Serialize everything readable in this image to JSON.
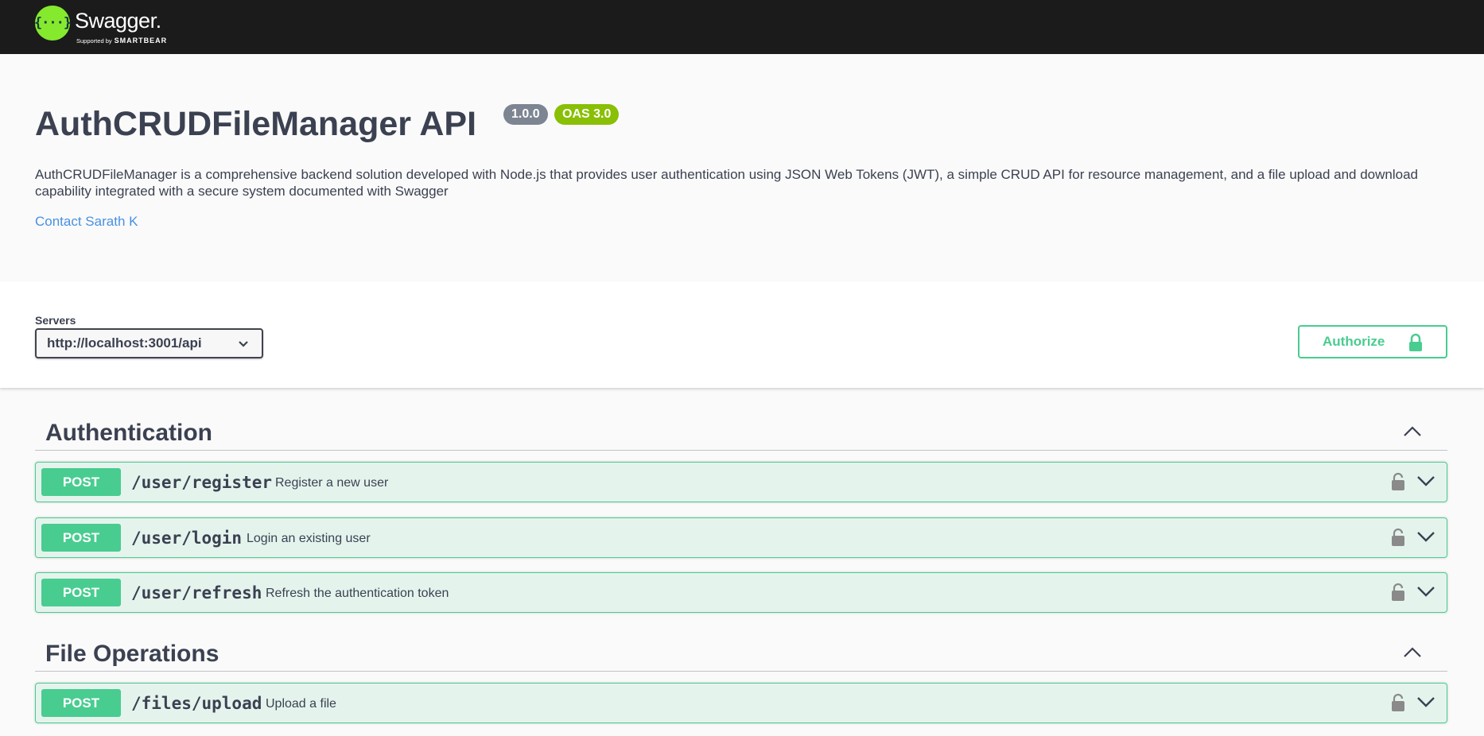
{
  "topbar": {
    "logo_mark": "{···}",
    "logo_name": "Swagger.",
    "logo_supported": "Supported by",
    "logo_brand": "SMARTBEAR"
  },
  "info": {
    "title": "AuthCRUDFileManager API",
    "version": "1.0.0",
    "oas": "OAS 3.0",
    "description": "AuthCRUDFileManager is a comprehensive backend solution developed with Node.js that provides user authentication using JSON Web Tokens (JWT), a simple CRUD API for resource management, and a file upload and download capability integrated with a secure system documented with Swagger",
    "contact": "Contact Sarath K"
  },
  "servers": {
    "label": "Servers",
    "selected": "http://localhost:3001/api"
  },
  "authorize": {
    "label": "Authorize"
  },
  "sections": [
    {
      "title": "Authentication",
      "operations": [
        {
          "method": "POST",
          "path": "/user/register",
          "summary": "Register a new user"
        },
        {
          "method": "POST",
          "path": "/user/login",
          "summary": "Login an existing user"
        },
        {
          "method": "POST",
          "path": "/user/refresh",
          "summary": "Refresh the authentication token"
        }
      ]
    },
    {
      "title": "File Operations",
      "operations": [
        {
          "method": "POST",
          "path": "/files/upload",
          "summary": "Upload a file"
        }
      ]
    }
  ],
  "colors": {
    "post": "#49cc90",
    "topbar": "#1b1b1b",
    "link": "#4990e2",
    "oas_badge": "#89bf04",
    "version_badge": "#7d8492"
  },
  "icons": [
    "swagger-logo-icon",
    "chevron-down-icon",
    "lock-icon",
    "unlock-icon",
    "chevron-up-icon"
  ]
}
